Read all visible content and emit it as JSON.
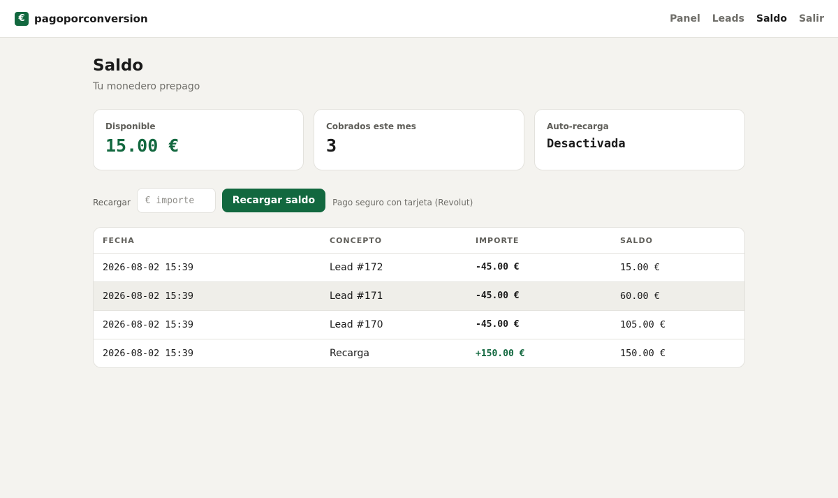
{
  "brand": {
    "logo_symbol": "€",
    "name": "pagoporconversion"
  },
  "nav": [
    {
      "label": "Panel",
      "active": false
    },
    {
      "label": "Leads",
      "active": false
    },
    {
      "label": "Saldo",
      "active": true
    },
    {
      "label": "Salir",
      "active": false
    }
  ],
  "page": {
    "title": "Saldo",
    "subtitle": "Tu monedero prepago"
  },
  "cards": [
    {
      "label": "Disponible",
      "value": "15.00 €"
    },
    {
      "label": "Cobrados este mes",
      "value": "3"
    },
    {
      "label": "Auto-recarga",
      "value": "Desactivada"
    }
  ],
  "recharge": {
    "label": "Recargar",
    "placeholder": "€ importe",
    "value": "",
    "button_label": "Recargar saldo",
    "note": "Pago seguro con tarjeta (Revolut)"
  },
  "table": {
    "headers": [
      "FECHA",
      "CONCEPTO",
      "IMPORTE",
      "SALDO"
    ],
    "rows": [
      {
        "fecha": "2026-08-02 15:39",
        "concepto": "Lead #172",
        "importe": "-45.00 €",
        "saldo": "15.00 €"
      },
      {
        "fecha": "2026-08-02 15:39",
        "concepto": "Lead #171",
        "importe": "-45.00 €",
        "saldo": "60.00 €"
      },
      {
        "fecha": "2026-08-02 15:39",
        "concepto": "Lead #170",
        "importe": "-45.00 €",
        "saldo": "105.00 €"
      },
      {
        "fecha": "2026-08-02 15:39",
        "concepto": "Recarga",
        "importe": "+150.00 €",
        "saldo": "150.00 €"
      }
    ]
  },
  "colors": {
    "accent": "#12683f",
    "background": "#f4f3ef",
    "card_background": "#ffffff",
    "border": "#e3e2dd",
    "muted_text": "#6f6e69",
    "row_highlight": "#efeee9"
  }
}
